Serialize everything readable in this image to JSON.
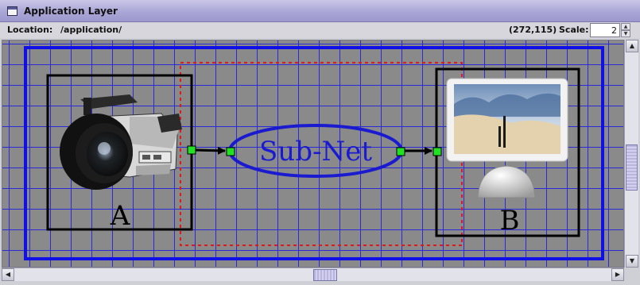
{
  "window": {
    "title": "Application Layer",
    "icon": "window-icon"
  },
  "toolbar": {
    "location_label": "Location:",
    "location_value": "/application/",
    "coords": "(272,115)",
    "scale_label": "Scale:",
    "scale_value": "2"
  },
  "canvas": {
    "node_a": {
      "label": "A",
      "icon": "video-camera-image"
    },
    "node_b": {
      "label": "B",
      "icon": "imac-monitor-image"
    },
    "subnet": {
      "label": "Sub-Net"
    },
    "colors": {
      "grid_line": "#2a2ad8",
      "background": "#8a8a8a",
      "outer_frame": "#1010e6",
      "selection_dashed": "#e01818",
      "port": "#22e022",
      "subnet": "#1a1ad0"
    }
  },
  "scrollbars": {
    "vertical": {
      "up_icon": "arrow-up-icon",
      "down_icon": "arrow-down-icon"
    },
    "horizontal": {
      "left_icon": "arrow-left-icon",
      "right_icon": "arrow-right-icon"
    }
  }
}
